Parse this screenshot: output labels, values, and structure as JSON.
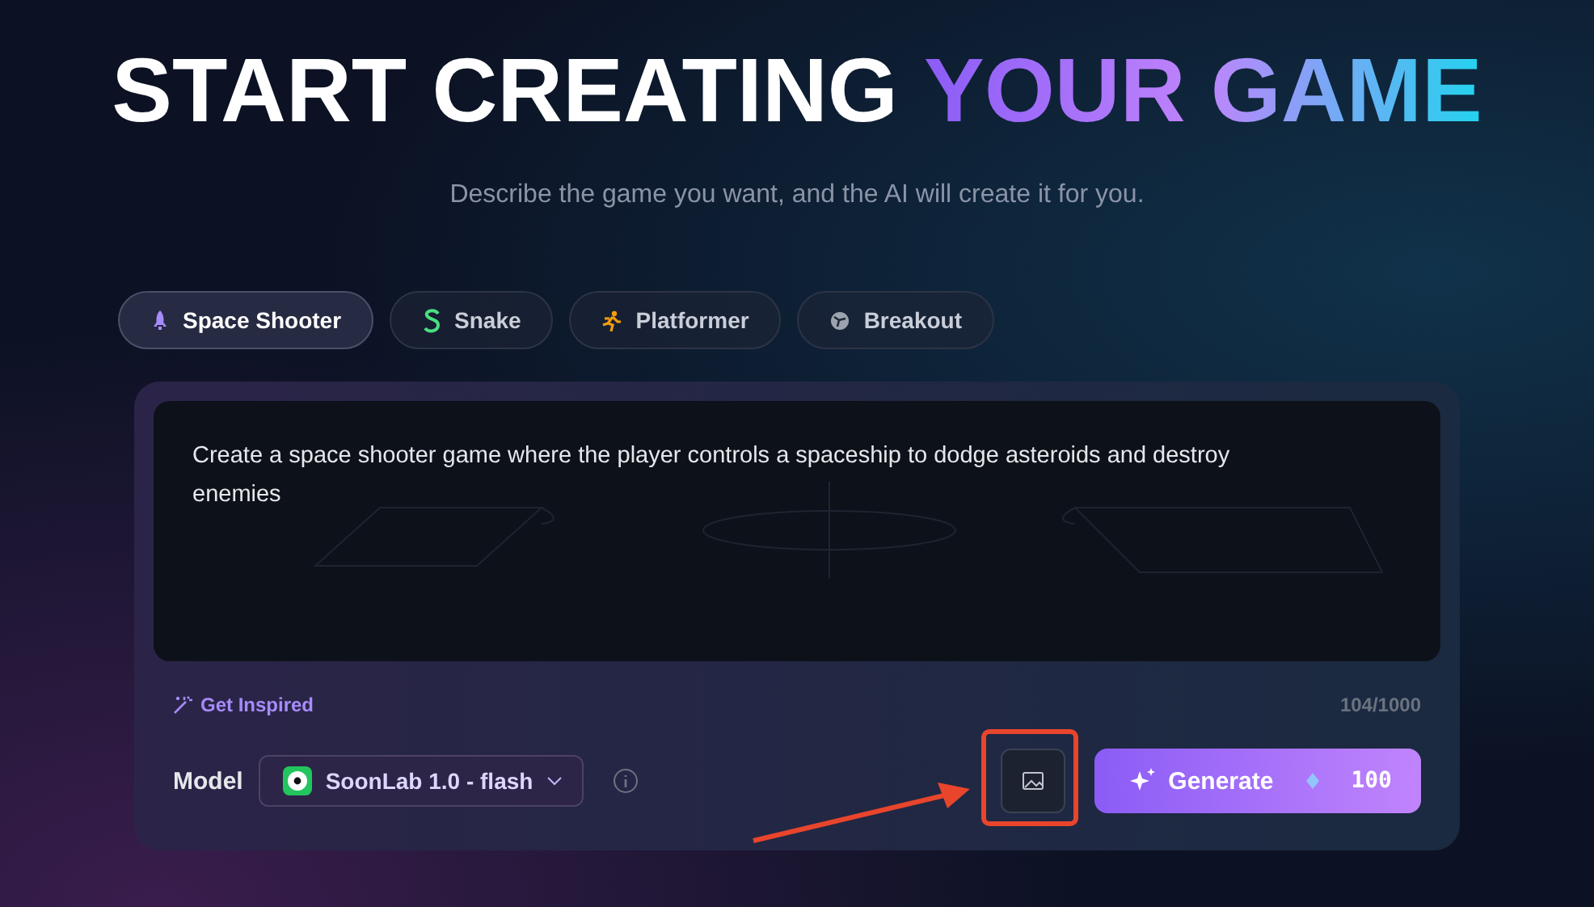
{
  "hero": {
    "title": "START CREATING",
    "title_highlight": "YOUR GAME",
    "subtitle": "Describe the game you want, and the AI will create it for you."
  },
  "tabs": [
    {
      "label": "Space Shooter",
      "kind": "rocket",
      "selected": true
    },
    {
      "label": "Snake",
      "kind": "snake",
      "selected": false
    },
    {
      "label": "Platformer",
      "kind": "runner",
      "selected": false
    },
    {
      "label": "Breakout",
      "kind": "ball",
      "selected": false
    }
  ],
  "prompt": {
    "value": "Create a space shooter game where the player controls a spaceship to dodge asteroids and destroy enemies",
    "inspire": "Get Inspired",
    "count": "104/1000"
  },
  "model": {
    "label": "Model",
    "value": "SoonLab 1.0 - flash"
  },
  "generate": {
    "label": "Generate",
    "cost": "100"
  }
}
